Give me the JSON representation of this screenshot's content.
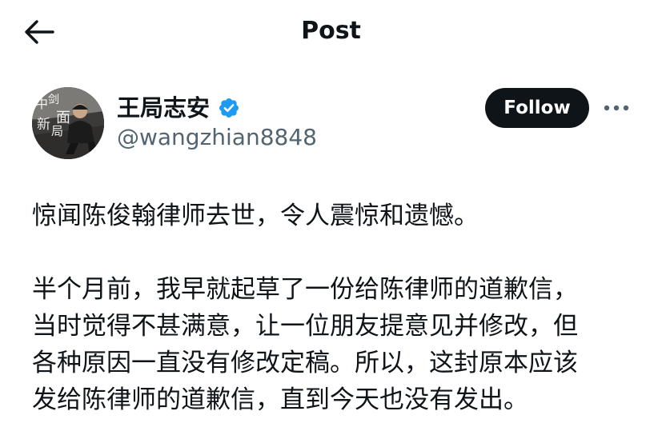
{
  "header": {
    "back_icon": "arrow-left-icon",
    "title": "Post"
  },
  "author": {
    "avatar_text": "中剑新局面",
    "name": "王局志安",
    "verified_icon": "verified-badge-icon",
    "handle": "@wangzhian8848"
  },
  "actions": {
    "follow_label": "Follow",
    "more_icon": "more-options-icon"
  },
  "post": {
    "paragraph_1": "惊闻陈俊翰律师去世，令人震惊和遗憾。",
    "paragraph_2": "半个月前，我早就起草了一份给陈律师的道歉信，\n当时觉得不甚满意，让一位朋友提意见并修改，但\n各种原因一直没有修改定稿。所以，这封原本应该\n发给陈律师的道歉信，直到今天也没有发出。"
  },
  "colors": {
    "text": "#0f1419",
    "secondary_text": "#536471",
    "verified_blue": "#1d9bf0",
    "follow_bg": "#0f1419",
    "follow_text": "#ffffff"
  }
}
